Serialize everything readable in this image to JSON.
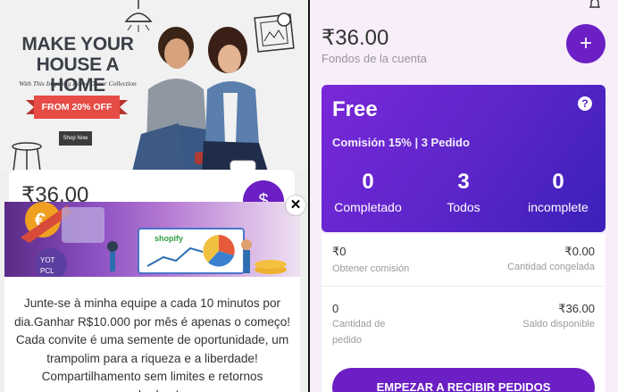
{
  "left_app": {
    "banner": {
      "headline": "MAKE YOUR HOUSE A HOME",
      "tagline": "With This Inspiring Home Decor Collection",
      "discount": "FROM 20% OFF",
      "cta": "Shop Now"
    },
    "balance": "₹36.00",
    "popup": {
      "banner_brand": "shopify",
      "banner_labels": [
        "YOT",
        "PCL"
      ],
      "message": "Junte-se à minha equipe a cada 10 minutos por dia.Ganhar R$10.000 por mês é apenas o começo! Cada convite é uma semente de oportunidade, um trampolim para a riqueza e a liberdade! Compartilhamento sem limites e retornos soberbos!",
      "close_icon": "✕"
    }
  },
  "right_app": {
    "balance": "₹36.00",
    "balance_label": "Fondos de la cuenta",
    "add_icon": "+",
    "plan": {
      "name": "Free",
      "help_icon": "?",
      "commission": "Comisión 15% | 3 Pedido",
      "stats": [
        {
          "value": "0",
          "label": "Completado"
        },
        {
          "value": "3",
          "label": "Todos"
        },
        {
          "value": "0",
          "label": "incomplete"
        }
      ]
    },
    "info": {
      "commission_value": "₹0",
      "commission_label": "Obtener comisión",
      "frozen_value": "₹0.00",
      "frozen_label": "Cantidad congelada",
      "orders_value": "0",
      "orders_label": "Cantidad de pedido",
      "available_value": "₹36.00",
      "available_label": "Saldo disponible"
    },
    "cta": "EMPEZAR A RECIBIR PEDIDOS"
  },
  "colors": {
    "primary": "#6b1fc4",
    "ribbon": "#e64b45"
  }
}
